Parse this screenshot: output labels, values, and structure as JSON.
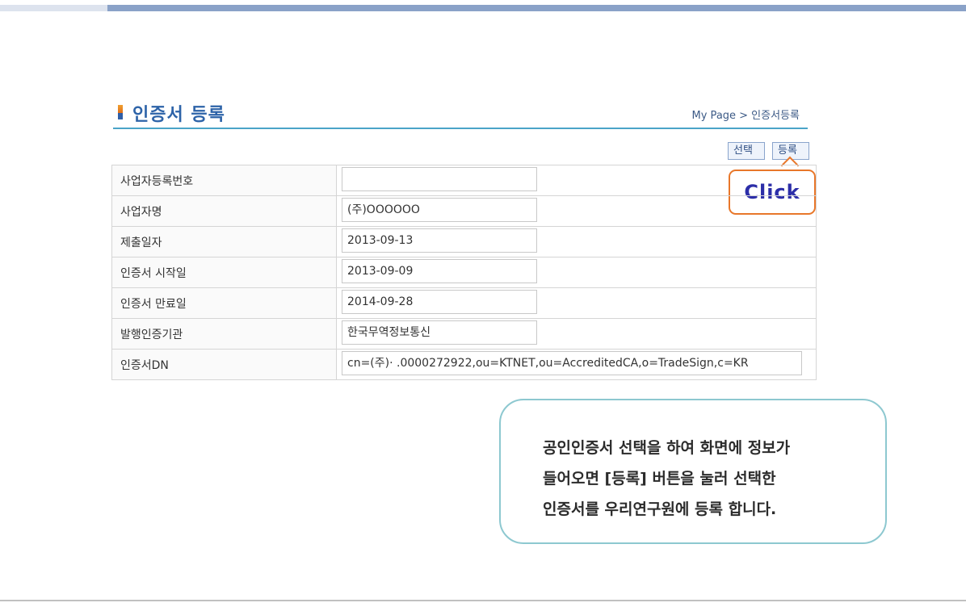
{
  "page": {
    "title": "인증서 등록",
    "breadcrumb": "My Page > 인증서등록"
  },
  "buttons": {
    "select_label": "선택",
    "register_label": "등록"
  },
  "callout": {
    "text": "Click"
  },
  "form": {
    "rows": [
      {
        "label": "사업자등록번호",
        "value": ""
      },
      {
        "label": "사업자명",
        "value": "(주)OOOOOO"
      },
      {
        "label": "제출일자",
        "value": "2013-09-13"
      },
      {
        "label": "인증서 시작일",
        "value": "2013-09-09"
      },
      {
        "label": "인증서 만료일",
        "value": "2014-09-28"
      },
      {
        "label": "발행인증기관",
        "value": "한국무역정보통신"
      },
      {
        "label": "인증서DN",
        "value": "cn=(주)·                    .0000272922,ou=KTNET,ou=AccreditedCA,o=TradeSign,c=KR"
      }
    ]
  },
  "info": {
    "line1": "공인인증서 선택을 하여 화면에 정보가",
    "line2": "들어오면 [등록] 버튼을 눌러 선택한",
    "line3": "인증서를 우리연구원에 등록 합니다."
  },
  "colors": {
    "accent": "#2d63a8",
    "callout_border": "#e8772a",
    "info_border": "#8dc8d0"
  }
}
